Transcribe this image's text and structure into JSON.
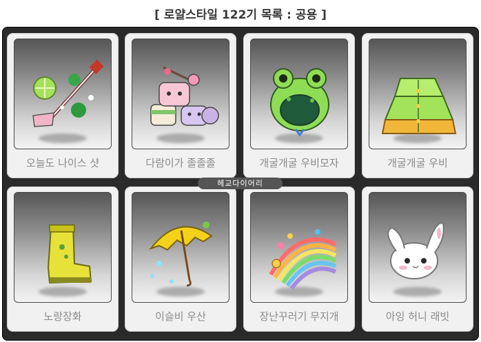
{
  "header": {
    "title": "[ 로얄스타일 122기 목록 : 공용 ]"
  },
  "items": [
    {
      "label": "오늘도 나이스 샷",
      "icon": "golf-club-icon"
    },
    {
      "label": "다람이가 졸졸졸",
      "icon": "squirrel-pile-icon"
    },
    {
      "label": "개굴개굴 우비모자",
      "icon": "frog-hat-icon"
    },
    {
      "label": "개굴개굴 우비",
      "icon": "frog-raincoat-icon"
    },
    {
      "label": "노랑장화",
      "icon": "yellow-boot-icon"
    },
    {
      "label": "이슬비 우산",
      "icon": "yellow-umbrella-icon"
    },
    {
      "label": "장난꾸러기 무지개",
      "icon": "rainbow-icon"
    },
    {
      "label": "아잉 허니 래빗",
      "icon": "bunny-icon"
    }
  ],
  "watermark": {
    "text": "헤교다이어리"
  }
}
